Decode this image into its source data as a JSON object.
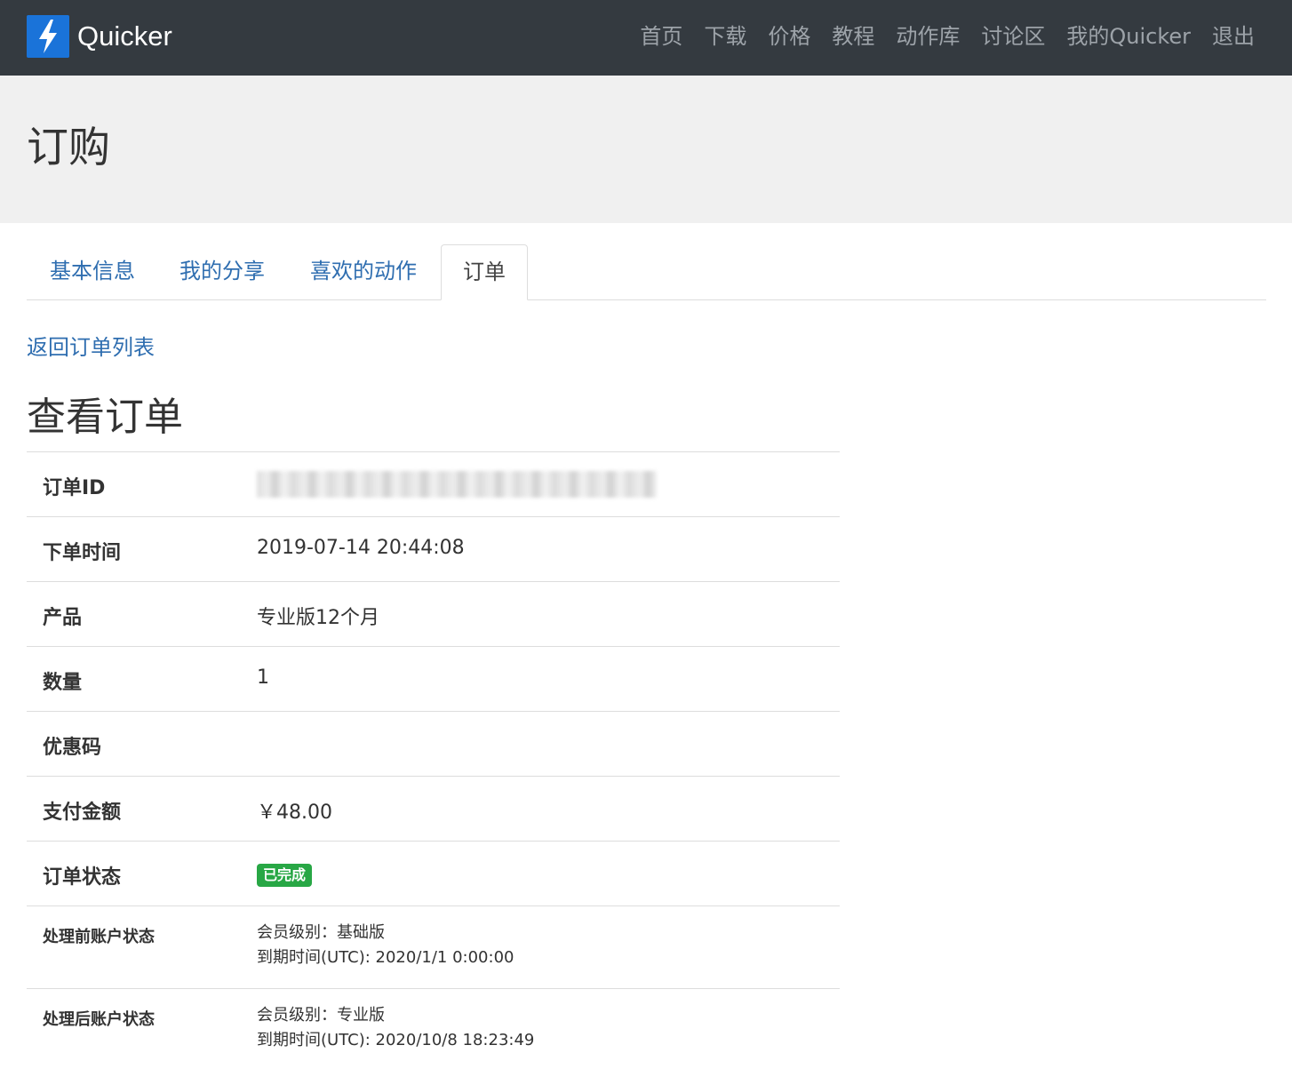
{
  "navbar": {
    "brand": "Quicker",
    "links": [
      "首页",
      "下载",
      "价格",
      "教程",
      "动作库",
      "讨论区",
      "我的Quicker",
      "退出"
    ]
  },
  "header": {
    "title": "订购"
  },
  "tabs": [
    "基本信息",
    "我的分享",
    "喜欢的动作",
    "订单"
  ],
  "active_tab": "订单",
  "back_link": "返回订单列表",
  "section_title": "查看订单",
  "order": {
    "id_label": "订单ID",
    "id_value": "",
    "time_label": "下单时间",
    "time_value": "2019-07-14 20:44:08",
    "product_label": "产品",
    "product_value": "专业版12个月",
    "quantity_label": "数量",
    "quantity_value": "1",
    "coupon_label": "优惠码",
    "coupon_value": "",
    "amount_label": "支付金额",
    "amount_value": "￥48.00",
    "status_label": "订单状态",
    "status_value": "已完成",
    "before_label": "处理前账户状态",
    "before_level": "会员级别：基础版",
    "before_expiry": "到期时间(UTC): 2020/1/1 0:00:00",
    "after_label": "处理后账户状态",
    "after_level": "会员级别：专业版",
    "after_expiry": "到期时间(UTC): 2020/10/8 18:23:49"
  },
  "colors": {
    "navbar_bg": "#343a40",
    "link": "#2f6eb0",
    "badge_success": "#28a745",
    "logo_blue": "#1a73d9"
  }
}
